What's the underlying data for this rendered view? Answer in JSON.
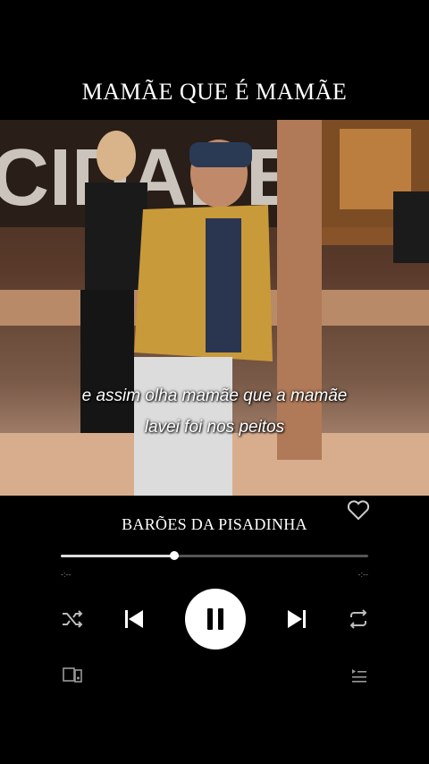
{
  "header": {
    "title": "MAMÃE QUE É MAMÃE"
  },
  "video": {
    "lyrics_line1": "e assim olha mamãe que a mamãe",
    "lyrics_line2": "lavei foi nos peitos"
  },
  "player": {
    "song_title": "BARÕES DA PISADINHA",
    "progress_fraction": 0.37,
    "elapsed": "-:--",
    "remaining": "-:--",
    "icons": [
      "heart-icon",
      "shuffle-icon",
      "previous-icon",
      "pause-icon",
      "next-icon",
      "repeat-icon",
      "devices-icon",
      "queue-icon"
    ]
  }
}
